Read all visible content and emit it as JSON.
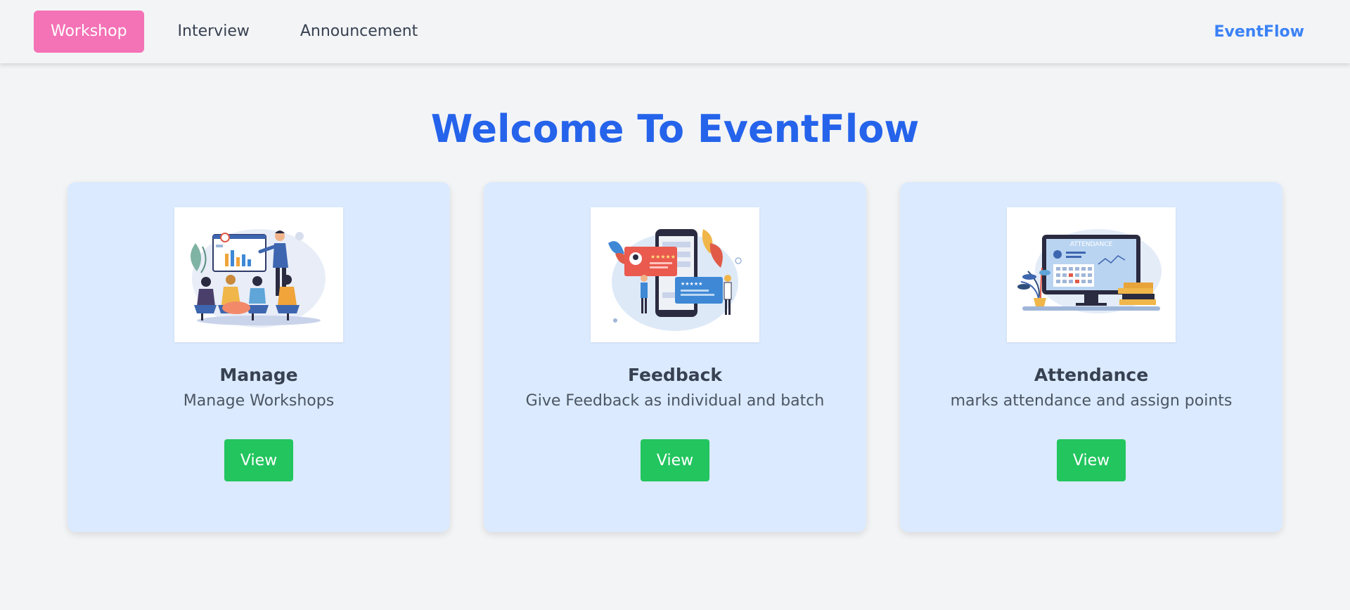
{
  "nav": {
    "items": [
      {
        "label": "Workshop",
        "active": true
      },
      {
        "label": "Interview",
        "active": false
      },
      {
        "label": "Announcement",
        "active": false
      }
    ],
    "brand": "EventFlow"
  },
  "page": {
    "title": "Welcome To EventFlow"
  },
  "cards": [
    {
      "title": "Manage",
      "description": "Manage Workshops",
      "button_label": "View",
      "illustration": "presentation-illustration"
    },
    {
      "title": "Feedback",
      "description": "Give Feedback as individual and batch",
      "button_label": "View",
      "illustration": "feedback-illustration"
    },
    {
      "title": "Attendance",
      "description": "marks attendance and assign points",
      "button_label": "View",
      "illustration": "attendance-illustration",
      "illustration_text": "ATTENDANCE"
    }
  ],
  "colors": {
    "accent_active_tab": "#f472b6",
    "brand": "#3b82f6",
    "title": "#2563eb",
    "card_bg": "#dbeafe",
    "button": "#22c55e",
    "page_bg": "#f3f4f6"
  }
}
